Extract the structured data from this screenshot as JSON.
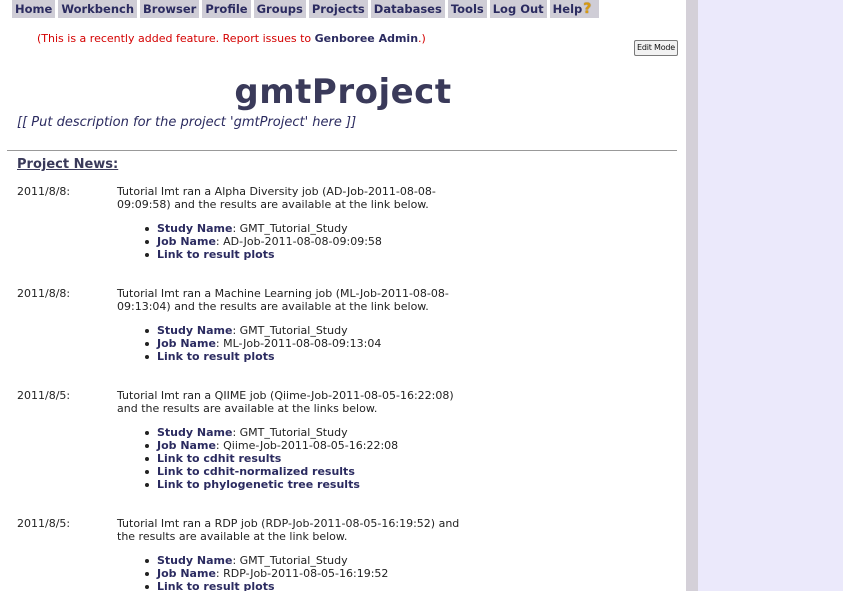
{
  "nav": {
    "items": [
      "Home",
      "Workbench",
      "Browser",
      "Profile",
      "Groups",
      "Projects",
      "Databases",
      "Tools",
      "Log Out",
      "Help"
    ],
    "help_icon": "question-mark-icon"
  },
  "notice": {
    "prefix": "(This is a recently added feature. Report issues to ",
    "link": "Genboree Admin",
    "suffix": ".)"
  },
  "edit_mode_label": "Edit Mode",
  "project": {
    "title": "gmtProject",
    "description": "[[ Put description for the project 'gmtProject' here ]]"
  },
  "news_heading": "Project News:",
  "news": [
    {
      "date": "2011/8/8:",
      "text": "Tutorial Imt ran a Alpha Diversity job (AD-Job-2011-08-08-09:09:58) and the results are available at the link below.",
      "study_label": "Study Name",
      "study_name": ": GMT_Tutorial_Study",
      "job_label": "Job Name",
      "job_name": ": AD-Job-2011-08-08-09:09:58",
      "links": [
        "Link to result plots"
      ]
    },
    {
      "date": "2011/8/8:",
      "text": "Tutorial Imt ran a Machine Learning job (ML-Job-2011-08-08-09:13:04) and the results are available at the link below.",
      "study_label": "Study Name",
      "study_name": ": GMT_Tutorial_Study",
      "job_label": "Job Name",
      "job_name": ": ML-Job-2011-08-08-09:13:04",
      "links": [
        "Link to result plots"
      ]
    },
    {
      "date": "2011/8/5:",
      "text": "Tutorial Imt ran a QIIME job (Qiime-Job-2011-08-05-16:22:08) and the results are available at the links below.",
      "study_label": "Study Name",
      "study_name": ": GMT_Tutorial_Study",
      "job_label": "Job Name",
      "job_name": ": Qiime-Job-2011-08-05-16:22:08",
      "links": [
        "Link to cdhit results",
        "Link to cdhit-normalized results",
        "Link to phylogenetic tree results"
      ]
    },
    {
      "date": "2011/8/5:",
      "text": "Tutorial Imt ran a RDP job (RDP-Job-2011-08-05-16:19:52) and the results are available at the link below.",
      "study_label": "Study Name",
      "study_name": ": GMT_Tutorial_Study",
      "job_label": "Job Name",
      "job_name": ": RDP-Job-2011-08-05-16:19:52",
      "links": [
        "Link to result plots"
      ]
    }
  ]
}
